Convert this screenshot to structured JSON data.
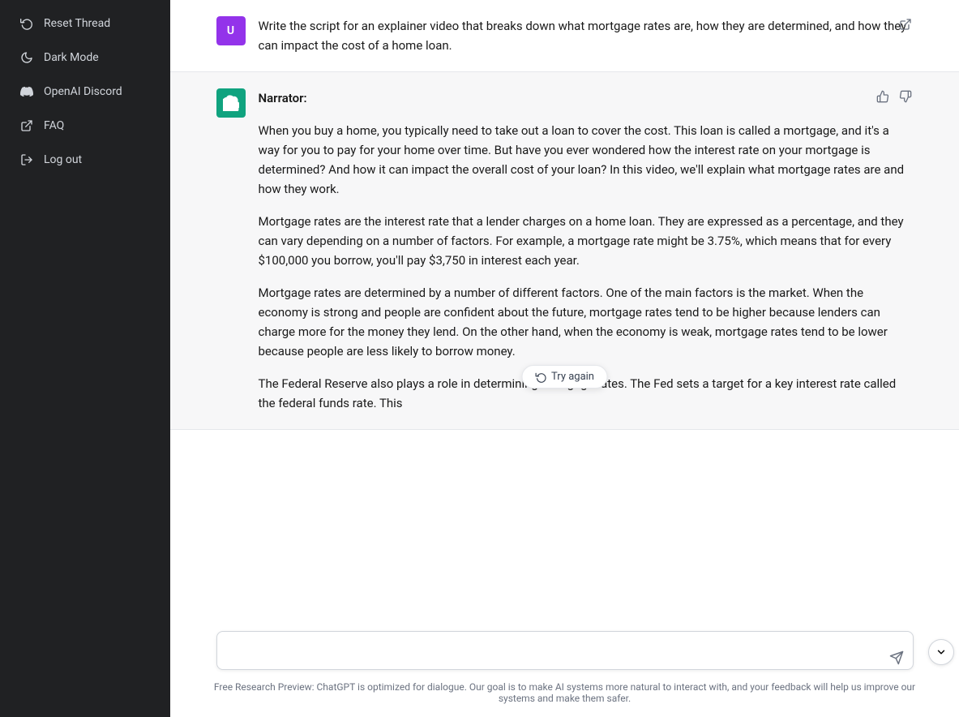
{
  "sidebar": {
    "items": [
      {
        "id": "reset-thread",
        "label": "Reset Thread",
        "icon": "reset"
      },
      {
        "id": "dark-mode",
        "label": "Dark Mode",
        "icon": "moon"
      },
      {
        "id": "openai-discord",
        "label": "OpenAI Discord",
        "icon": "discord"
      },
      {
        "id": "faq",
        "label": "FAQ",
        "icon": "external-link"
      },
      {
        "id": "log-out",
        "label": "Log out",
        "icon": "arrow-right"
      }
    ]
  },
  "chat": {
    "messages": [
      {
        "id": "user-1",
        "role": "user",
        "text": "Write the script for an explainer video that breaks down what mortgage rates are, how they are determined, and how they can impact the cost of a home loan."
      },
      {
        "id": "ai-1",
        "role": "ai",
        "narrator_label": "Narrator:",
        "paragraphs": [
          "When you buy a home, you typically need to take out a loan to cover the cost. This loan is called a mortgage, and it's a way for you to pay for your home over time. But have you ever wondered how the interest rate on your mortgage is determined? And how it can impact the overall cost of your loan? In this video, we'll explain what mortgage rates are and how they work.",
          "Mortgage rates are the interest rate that a lender charges on a home loan. They are expressed as a percentage, and they can vary depending on a number of factors. For example, a mortgage rate might be 3.75%, which means that for every $100,000 you borrow, you'll pay $3,750 in interest each year.",
          "Mortgage rates are determined by a number of different factors. One of the main factors is the market. When the economy is strong and people are confident about the future, mortgage rates tend to be higher because lenders can charge more for the money they lend. On the other hand, when the economy is weak, mortgage rates tend to be lower because people are less likely to borrow money.",
          "The Federal Reserve also plays a role in determining mortgage rates. The Fed sets a target for a key interest rate called the federal funds rate. This"
        ]
      }
    ],
    "input_placeholder": "",
    "try_again_label": "Try again",
    "send_icon_label": "send-icon",
    "scroll_down_label": "scroll-down"
  },
  "footer": {
    "text": "Free Research Preview: ChatGPT is optimized for dialogue. Our goal is to make AI systems more natural to interact with, and your feedback will help us improve our systems and make them safer."
  }
}
